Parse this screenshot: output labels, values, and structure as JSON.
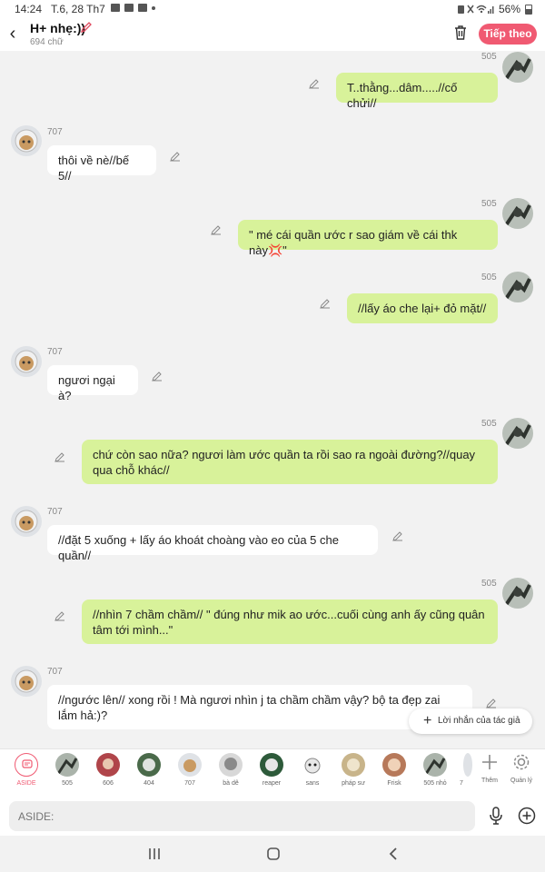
{
  "status": {
    "time": "14:24",
    "date": "T.6, 28 Th7",
    "battery": "56%"
  },
  "header": {
    "title": "H+ nhẹ:))",
    "subtitle": "694 chữ",
    "next_label": "Tiếp theo"
  },
  "messages": [
    {
      "side": "right",
      "name": "505",
      "text": "T..thằng...dâm.....//cố chửi//"
    },
    {
      "side": "left",
      "name": "707",
      "text": "thôi về nè//bế 5//"
    },
    {
      "side": "right",
      "name": "505",
      "text": "\" mé cái quần ước r sao giám về cái thk này💢\""
    },
    {
      "side": "right",
      "name": "505",
      "text": "//lấy áo che lại+ đỏ mặt//"
    },
    {
      "side": "left",
      "name": "707",
      "text": "ngươi ngại à?"
    },
    {
      "side": "right",
      "name": "505",
      "text": "chứ còn sao nữa? ngươi làm ước quần ta rồi sao ra ngoài đường?//quay qua chỗ khác//"
    },
    {
      "side": "left",
      "name": "707",
      "text": "//đặt 5 xuống + lấy áo khoát choàng vào eo của 5 che quần//"
    },
    {
      "side": "right",
      "name": "505",
      "text": "//nhìn 7 chầm chầm// \" đúng như mik ao ước...cuối cùng anh ấy cũng quân tâm tới mình...\""
    },
    {
      "side": "left",
      "name": "707",
      "text": "//ngước lên// xong rồi ! Mà ngươi nhìn j ta chầm chầm vậy? bộ ta đẹp zai lắm hả:)?"
    }
  ],
  "author_note_label": "Lời nhắn của tác giả",
  "characters": [
    {
      "label": "ASIDE",
      "active": true
    },
    {
      "label": "505"
    },
    {
      "label": "606"
    },
    {
      "label": "404"
    },
    {
      "label": "707"
    },
    {
      "label": "bà dê"
    },
    {
      "label": "reaper"
    },
    {
      "label": "sans"
    },
    {
      "label": "pháp sư"
    },
    {
      "label": "Frisk"
    },
    {
      "label": "505 nhỏ"
    },
    {
      "label": "7"
    }
  ],
  "add_label": "Thêm",
  "manage_label": "Quản lý",
  "input": {
    "placeholder": "ASIDE:"
  },
  "colors": {
    "accent": "#f05a72",
    "bubble_right": "#d8f29a",
    "bubble_left": "#ffffff",
    "background": "#f2f2f2"
  },
  "icons": [
    "back-icon",
    "edit-icon",
    "trash-icon",
    "plus-icon",
    "gear-icon",
    "mic-icon",
    "add-circle-icon",
    "recents-icon",
    "home-icon",
    "back-nav-icon"
  ]
}
